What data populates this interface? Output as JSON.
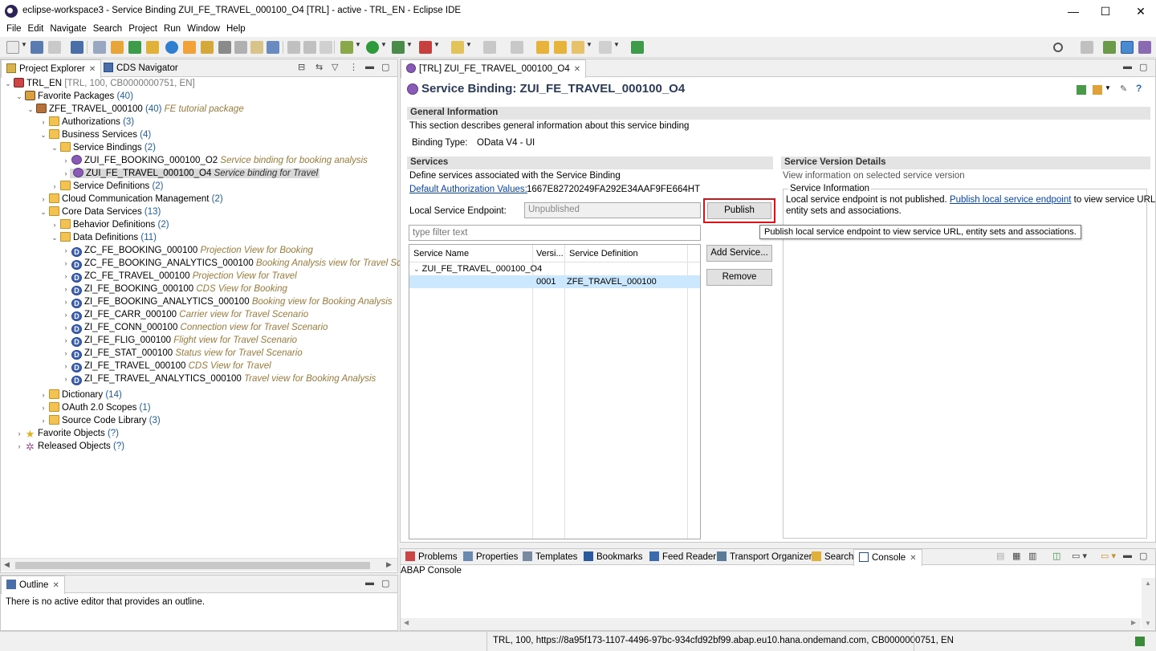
{
  "window": {
    "title": "eclipse-workspace3 - Service Binding ZUI_FE_TRAVEL_000100_O4 [TRL] - active - TRL_EN - Eclipse IDE",
    "minimize": "—",
    "maximize": "☐",
    "close": "✕"
  },
  "menu": [
    "File",
    "Edit",
    "Navigate",
    "Search",
    "Project",
    "Run",
    "Window",
    "Help"
  ],
  "left_tabs": {
    "project_explorer": "Project Explorer",
    "cds_navigator": "CDS Navigator"
  },
  "tree": {
    "root": {
      "label": "TRL_EN",
      "meta": "[TRL, 100, CB0000000751, EN]"
    },
    "favorite_packages": {
      "label": "Favorite Packages",
      "count": "(40)"
    },
    "package": {
      "label": "ZFE_TRAVEL_000100",
      "count": "(40)",
      "desc": "FE tutorial package"
    },
    "authorizations": {
      "label": "Authorizations",
      "count": "(3)"
    },
    "business_services": {
      "label": "Business Services",
      "count": "(4)"
    },
    "service_bindings": {
      "label": "Service Bindings",
      "count": "(2)"
    },
    "binding1": {
      "label": "ZUI_FE_BOOKING_000100_O2",
      "desc": "Service binding for booking analysis"
    },
    "binding2": {
      "label": "ZUI_FE_TRAVEL_000100_O4",
      "desc": "Service binding for Travel"
    },
    "service_definitions": {
      "label": "Service Definitions",
      "count": "(2)"
    },
    "cloud_comm": {
      "label": "Cloud Communication Management",
      "count": "(2)"
    },
    "core_data_services": {
      "label": "Core Data Services",
      "count": "(13)"
    },
    "behavior_definitions": {
      "label": "Behavior Definitions",
      "count": "(2)"
    },
    "data_definitions": {
      "label": "Data Definitions",
      "count": "(11)"
    },
    "ddls": [
      {
        "label": "ZC_FE_BOOKING_000100",
        "desc": "Projection View for Booking"
      },
      {
        "label": "ZC_FE_BOOKING_ANALYTICS_000100",
        "desc": "Booking Analysis view for Travel Scenario"
      },
      {
        "label": "ZC_FE_TRAVEL_000100",
        "desc": "Projection View for Travel"
      },
      {
        "label": "ZI_FE_BOOKING_000100",
        "desc": "CDS View for Booking"
      },
      {
        "label": "ZI_FE_BOOKING_ANALYTICS_000100",
        "desc": "Booking view for Booking Analysis"
      },
      {
        "label": "ZI_FE_CARR_000100",
        "desc": "Carrier view for Travel Scenario"
      },
      {
        "label": "ZI_FE_CONN_000100",
        "desc": "Connection view for Travel Scenario"
      },
      {
        "label": "ZI_FE_FLIG_000100",
        "desc": "Flight view for Travel Scenario"
      },
      {
        "label": "ZI_FE_STAT_000100",
        "desc": "Status view for Travel Scenario"
      },
      {
        "label": "ZI_FE_TRAVEL_000100",
        "desc": "CDS View for Travel"
      },
      {
        "label": "ZI_FE_TRAVEL_ANALYTICS_000100",
        "desc": "Travel view for Booking Analysis"
      }
    ],
    "dictionary": {
      "label": "Dictionary",
      "count": "(14)"
    },
    "oauth": {
      "label": "OAuth 2.0 Scopes",
      "count": "(1)"
    },
    "source_code_library": {
      "label": "Source Code Library",
      "count": "(3)"
    },
    "favorite_objects": {
      "label": "Favorite Objects",
      "count": "(?)"
    },
    "released_objects": {
      "label": "Released Objects",
      "count": "(?)"
    }
  },
  "outline": {
    "tab": "Outline",
    "message": "There is no active editor that provides an outline."
  },
  "editor": {
    "tab": "[TRL] ZUI_FE_TRAVEL_000100_O4",
    "heading": "Service Binding: ZUI_FE_TRAVEL_000100_O4",
    "general": {
      "title": "General Information",
      "desc": "This section describes general information about this service binding",
      "binding_type_label": "Binding Type:",
      "binding_type_value": "OData V4 - UI"
    },
    "services": {
      "title": "Services",
      "desc": "Define services associated with the Service Binding",
      "auth_link": "Default Authorization Values:",
      "auth_value": "1667E82720249FA292E34AAF9FE664HT",
      "endpoint_label": "Local Service Endpoint:",
      "endpoint_value": "Unpublished",
      "publish": "Publish",
      "filter_placeholder": "type filter text",
      "columns": [
        "Service Name",
        "Versi...",
        "Service Definition"
      ],
      "service_name": "ZUI_FE_TRAVEL_000100_O4",
      "row_version": "0001",
      "row_definition": "ZFE_TRAVEL_000100",
      "add_service": "Add Service...",
      "remove": "Remove"
    },
    "version_details": {
      "title": "Service Version Details",
      "desc": "View information on selected service version",
      "group": "Service Information",
      "msg_prefix": "Local service endpoint is not published.",
      "msg_link": "Publish local service endpoint",
      "msg_suffix": "to view service URL,",
      "msg_line2": "entity sets and associations."
    },
    "tooltip": "Publish local service endpoint to view service URL, entity sets and associations."
  },
  "bottom_tabs": [
    "Problems",
    "Properties",
    "Templates",
    "Bookmarks",
    "Feed Reader",
    "Transport Organizer",
    "Search",
    "Console"
  ],
  "console": {
    "title": "ABAP Console"
  },
  "status": "TRL, 100, https://8a95f173-1107-4496-97bc-934cfd92bf99.abap.eu10.hana.ondemand.com, CB0000000751, EN"
}
